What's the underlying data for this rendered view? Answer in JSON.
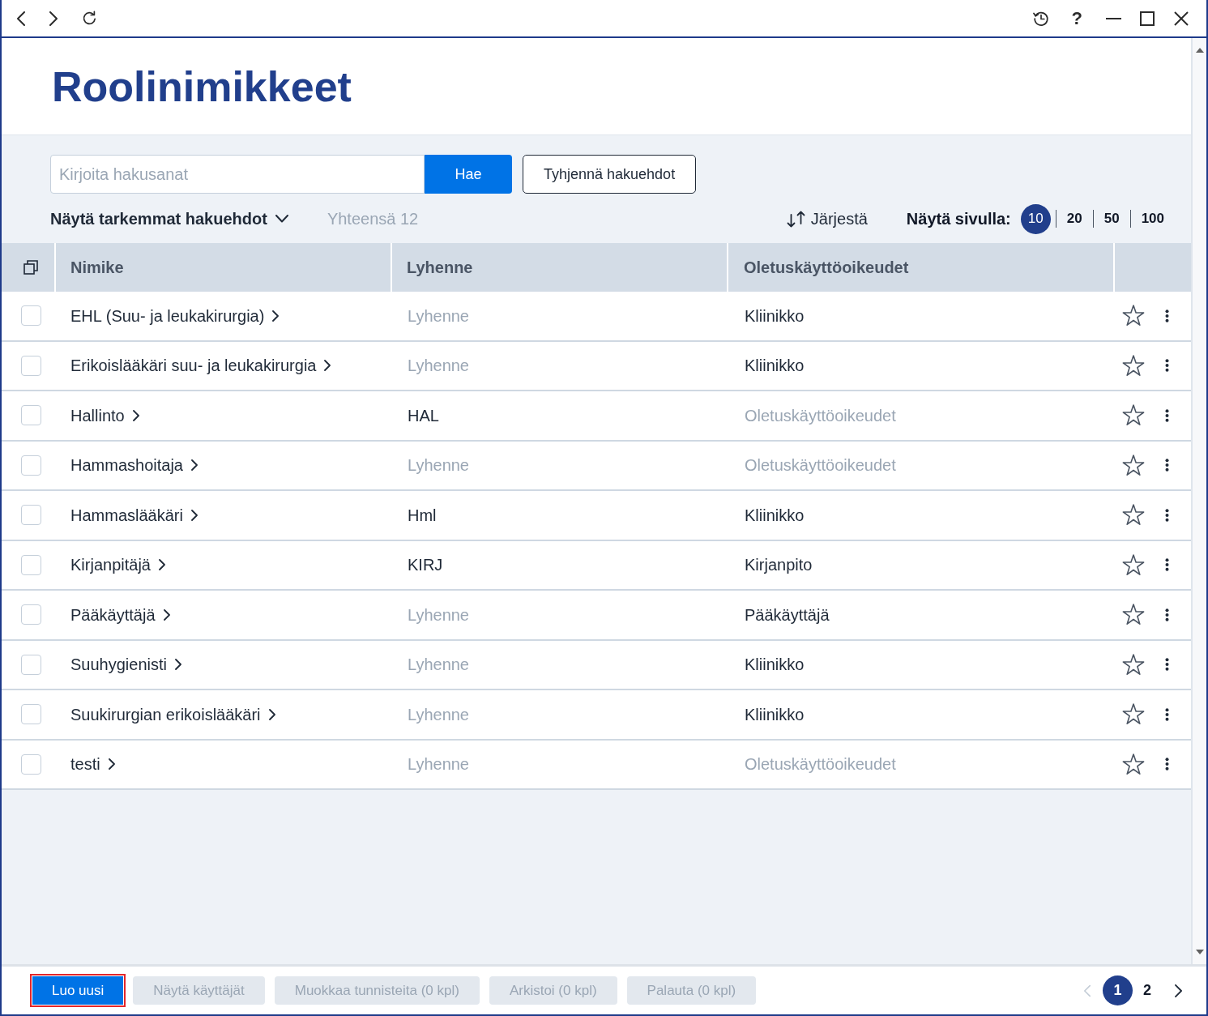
{
  "window": {
    "help_button": "?"
  },
  "page": {
    "title": "Roolinimikkeet"
  },
  "search": {
    "placeholder": "Kirjoita hakusanat",
    "search_button": "Hae",
    "clear_button": "Tyhjennä hakuehdot",
    "advanced_toggle": "Näytä tarkemmat hakuehdot",
    "expanded": false,
    "total": "Yhteensä 12"
  },
  "toolbar": {
    "sort_button": "Järjestä",
    "page_size_label": "Näytä sivulla:",
    "page_sizes": [
      {
        "label": "10",
        "selected": true
      },
      {
        "label": "20",
        "selected": false
      },
      {
        "label": "50",
        "selected": false
      },
      {
        "label": "100",
        "selected": false
      }
    ]
  },
  "table": {
    "columns": [
      "Nimike",
      "Lyhenne",
      "Oletuskäyttöoikeudet"
    ],
    "rows": [
      {
        "checked": false,
        "name": "EHL (Suu- ja leukakirurgia)",
        "abbreviation": {
          "text": "Lyhenne",
          "dimmed": true
        },
        "default_rights": {
          "text": "Kliinikko",
          "dimmed": false
        },
        "starred": false
      },
      {
        "checked": false,
        "name": "Erikoislääkäri suu- ja leukakirurgia",
        "abbreviation": {
          "text": "Lyhenne",
          "dimmed": true
        },
        "default_rights": {
          "text": "Kliinikko",
          "dimmed": false
        },
        "starred": false
      },
      {
        "checked": false,
        "name": "Hallinto",
        "abbreviation": {
          "text": "HAL",
          "dimmed": false
        },
        "default_rights": {
          "text": "Oletuskäyttöoikeudet",
          "dimmed": true
        },
        "starred": false
      },
      {
        "checked": false,
        "name": "Hammashoitaja",
        "abbreviation": {
          "text": "Lyhenne",
          "dimmed": true
        },
        "default_rights": {
          "text": "Oletuskäyttöoikeudet",
          "dimmed": true
        },
        "starred": false
      },
      {
        "checked": false,
        "name": "Hammaslääkäri",
        "abbreviation": {
          "text": "Hml",
          "dimmed": false
        },
        "default_rights": {
          "text": "Kliinikko",
          "dimmed": false
        },
        "starred": false
      },
      {
        "checked": false,
        "name": "Kirjanpitäjä",
        "abbreviation": {
          "text": "KIRJ",
          "dimmed": false
        },
        "default_rights": {
          "text": "Kirjanpito",
          "dimmed": false
        },
        "starred": false
      },
      {
        "checked": false,
        "name": "Pääkäyttäjä",
        "abbreviation": {
          "text": "Lyhenne",
          "dimmed": true
        },
        "default_rights": {
          "text": "Pääkäyttäjä",
          "dimmed": false
        },
        "starred": false
      },
      {
        "checked": false,
        "name": "Suuhygienisti",
        "abbreviation": {
          "text": "Lyhenne",
          "dimmed": true
        },
        "default_rights": {
          "text": "Kliinikko",
          "dimmed": false
        },
        "starred": false
      },
      {
        "checked": false,
        "name": "Suukirurgian erikoislääkäri",
        "abbreviation": {
          "text": "Lyhenne",
          "dimmed": true
        },
        "default_rights": {
          "text": "Kliinikko",
          "dimmed": false
        },
        "starred": false
      },
      {
        "checked": false,
        "name": "testi",
        "abbreviation": {
          "text": "Lyhenne",
          "dimmed": true
        },
        "default_rights": {
          "text": "Oletuskäyttöoikeudet",
          "dimmed": true
        },
        "starred": false
      }
    ]
  },
  "footer": {
    "actions": [
      {
        "label": "Luo uusi",
        "disabled": false,
        "focused": true
      },
      {
        "label": "Näytä käyttäjät",
        "disabled": true,
        "focused": false
      },
      {
        "label": "Muokkaa tunnisteita (0 kpl)",
        "disabled": true,
        "focused": false
      },
      {
        "label": "Arkistoi (0 kpl)",
        "disabled": true,
        "focused": false
      },
      {
        "label": "Palauta (0 kpl)",
        "disabled": true,
        "focused": false
      }
    ],
    "pagination": {
      "prev_disabled": true,
      "next_disabled": false,
      "pages": [
        {
          "label": "1",
          "selected": true
        },
        {
          "label": "2",
          "selected": false
        }
      ]
    }
  }
}
